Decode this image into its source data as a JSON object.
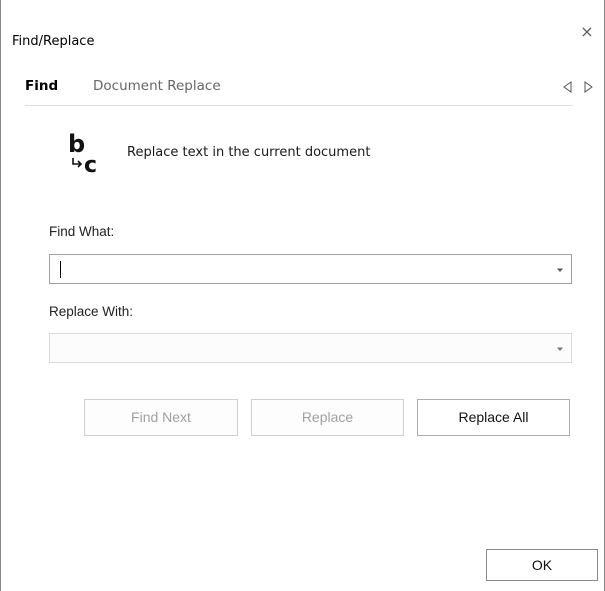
{
  "window": {
    "title": "Find/Replace",
    "close_glyph": "×"
  },
  "tabs": [
    {
      "label": "Find",
      "active": true
    },
    {
      "label": "Document Replace",
      "active": false
    }
  ],
  "tab_scroll": {
    "left_icon": "triangle-left-outline-icon",
    "right_icon": "triangle-right-outline-icon"
  },
  "header": {
    "icon": "replace-b-to-c-icon",
    "description": "Replace text in the current document"
  },
  "form": {
    "find_label": "Find What:",
    "find_value": "",
    "replace_label": "Replace With:",
    "replace_value": ""
  },
  "buttons": {
    "find_next": "Find Next",
    "replace": "Replace",
    "replace_all": "Replace All",
    "ok": "OK"
  },
  "colors": {
    "disabled_text": "#a0a0a0",
    "inactive_tab": "#666666"
  }
}
